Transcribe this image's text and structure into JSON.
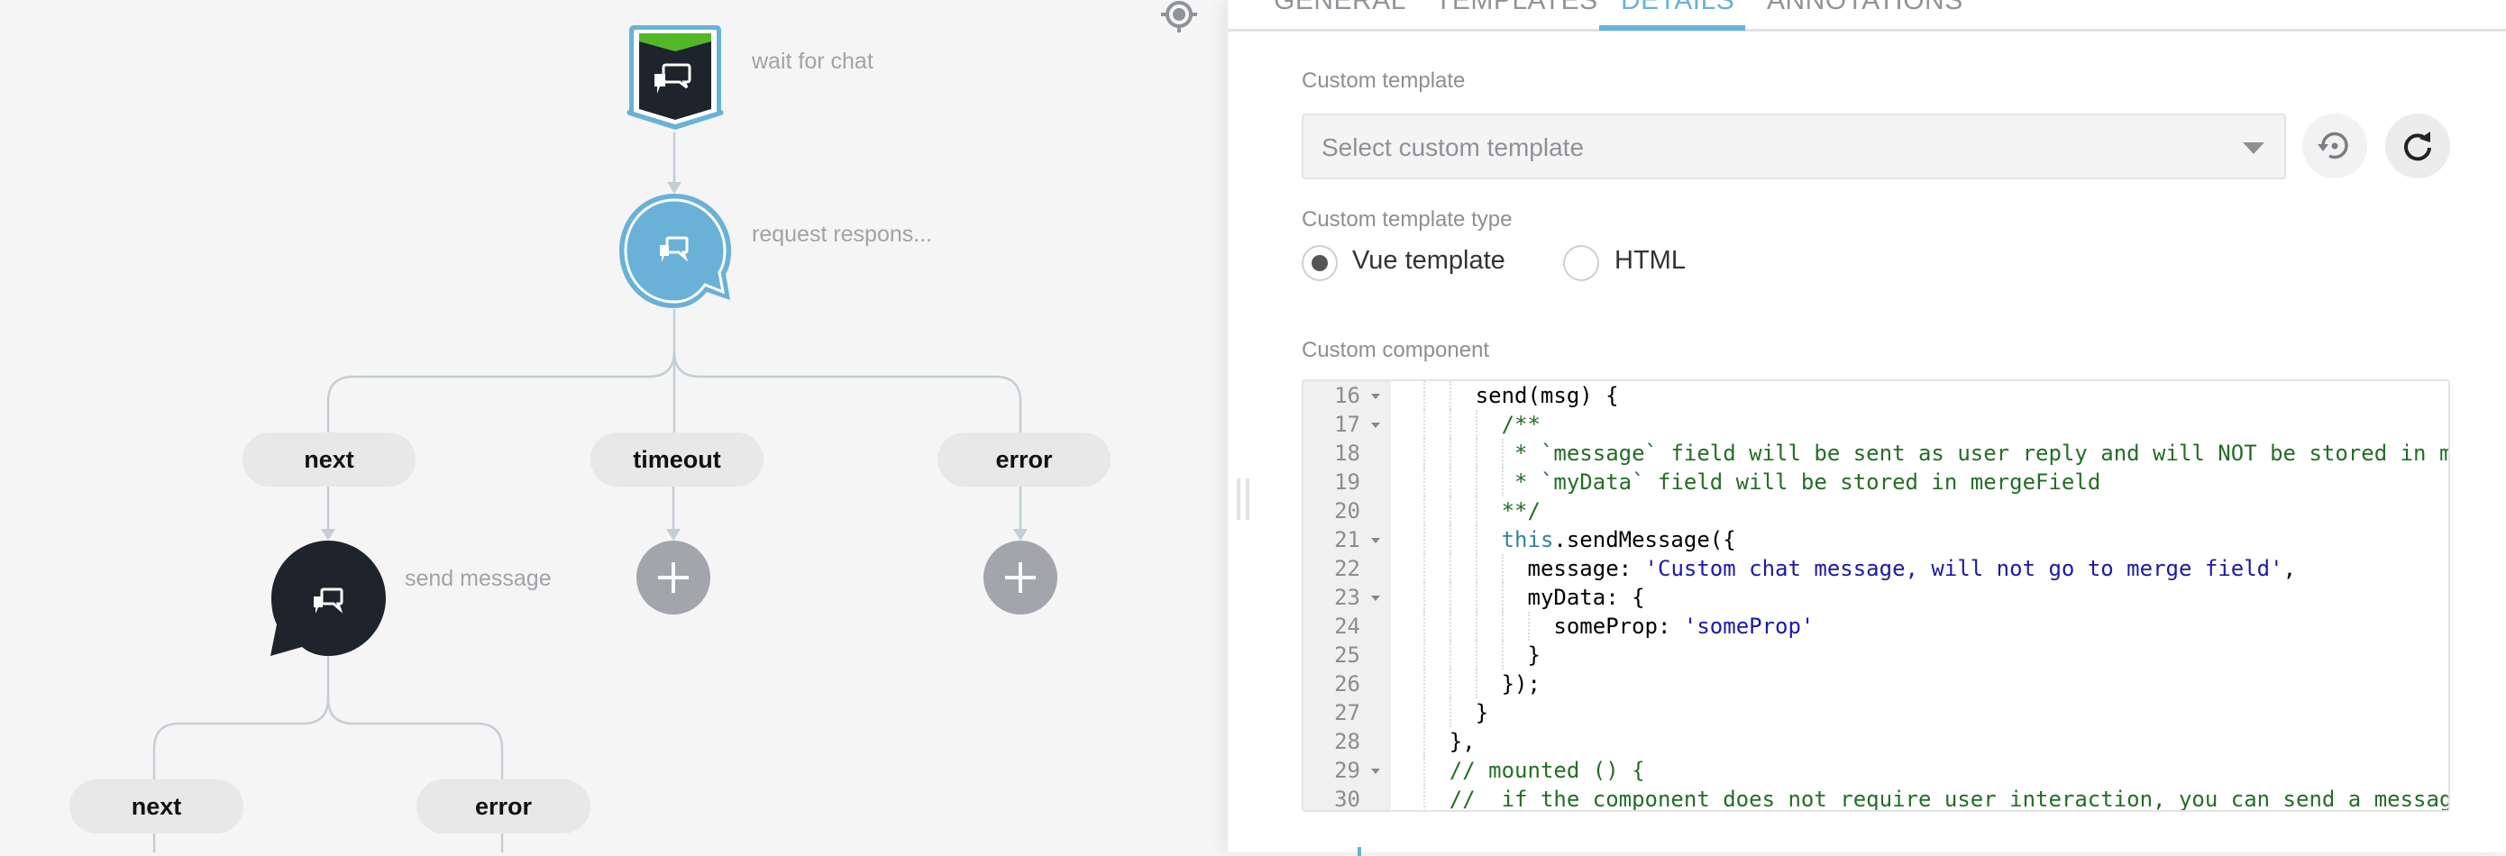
{
  "canvas": {
    "nodes": {
      "wait_for_chat": {
        "label": "wait for chat",
        "icon": "chat-bubbles-icon",
        "fill": "#1f232b",
        "outline": "#6ab1d8",
        "accent": "#52b828"
      },
      "request_response": {
        "label": "request respons...",
        "icon": "chat-bubbles-icon",
        "fill": "#6ab1d8"
      },
      "send_message": {
        "label": "send message",
        "icon": "chat-bubbles-icon",
        "fill": "#1f232b"
      }
    },
    "branches_level1": [
      {
        "label": "next"
      },
      {
        "label": "timeout"
      },
      {
        "label": "error"
      }
    ],
    "branches_level2": [
      {
        "label": "next"
      },
      {
        "label": "error"
      }
    ],
    "add_step_icon": "plus-icon",
    "locate_icon": "crosshair-icon"
  },
  "panel": {
    "tabs": [
      {
        "label": "GENERAL",
        "active": false
      },
      {
        "label": "TEMPLATES",
        "active": false
      },
      {
        "label": "DETAILS",
        "active": true
      },
      {
        "label": "ANNOTATIONS",
        "active": false
      }
    ],
    "accent_color": "#6ab1d8",
    "custom_template": {
      "label": "Custom template",
      "placeholder": "Select custom template",
      "value": "",
      "reset_icon": "restore-icon",
      "refresh_icon": "refresh-icon"
    },
    "template_type": {
      "label": "Custom template type",
      "options": [
        {
          "label": "Vue template",
          "checked": true
        },
        {
          "label": "HTML",
          "checked": false
        }
      ]
    },
    "custom_component": {
      "label": "Custom component",
      "lines": [
        {
          "n": "16",
          "fold": true,
          "indent": 6,
          "tokens": [
            {
              "t": "send(msg) {",
              "c": ""
            }
          ]
        },
        {
          "n": "17",
          "fold": true,
          "indent": 8,
          "tokens": [
            {
              "t": "/**",
              "c": "comment"
            }
          ]
        },
        {
          "n": "18",
          "fold": false,
          "indent": 9,
          "tokens": [
            {
              "t": "* `message` field will be sent as user reply and will NOT be stored in m",
              "c": "comment"
            }
          ]
        },
        {
          "n": "19",
          "fold": false,
          "indent": 9,
          "tokens": [
            {
              "t": "* `myData` field will be stored in mergeField",
              "c": "comment"
            }
          ]
        },
        {
          "n": "20",
          "fold": false,
          "indent": 8,
          "tokens": [
            {
              "t": "**/",
              "c": "comment"
            }
          ]
        },
        {
          "n": "21",
          "fold": true,
          "indent": 8,
          "tokens": [
            {
              "t": "this",
              "c": "keyword"
            },
            {
              "t": ".sendMessage({",
              "c": ""
            }
          ]
        },
        {
          "n": "22",
          "fold": false,
          "indent": 10,
          "tokens": [
            {
              "t": "message: ",
              "c": ""
            },
            {
              "t": "'Custom chat message, will not go to merge field'",
              "c": "string"
            },
            {
              "t": ",",
              "c": ""
            }
          ]
        },
        {
          "n": "23",
          "fold": true,
          "indent": 10,
          "tokens": [
            {
              "t": "myData: {",
              "c": ""
            }
          ]
        },
        {
          "n": "24",
          "fold": false,
          "indent": 12,
          "tokens": [
            {
              "t": "someProp: ",
              "c": ""
            },
            {
              "t": "'someProp'",
              "c": "string"
            }
          ]
        },
        {
          "n": "25",
          "fold": false,
          "indent": 10,
          "tokens": [
            {
              "t": "}",
              "c": ""
            }
          ]
        },
        {
          "n": "26",
          "fold": false,
          "indent": 8,
          "tokens": [
            {
              "t": "});",
              "c": ""
            }
          ]
        },
        {
          "n": "27",
          "fold": false,
          "indent": 6,
          "tokens": [
            {
              "t": "}",
              "c": ""
            }
          ]
        },
        {
          "n": "28",
          "fold": false,
          "indent": 4,
          "tokens": [
            {
              "t": "},",
              "c": ""
            }
          ]
        },
        {
          "n": "29",
          "fold": true,
          "indent": 4,
          "tokens": [
            {
              "t": "// mounted () {",
              "c": "comment"
            }
          ]
        },
        {
          "n": "30",
          "fold": false,
          "indent": 4,
          "tokens": [
            {
              "t": "//  if the component does not require user interaction, you can send a messag",
              "c": "comment"
            }
          ]
        }
      ]
    }
  }
}
